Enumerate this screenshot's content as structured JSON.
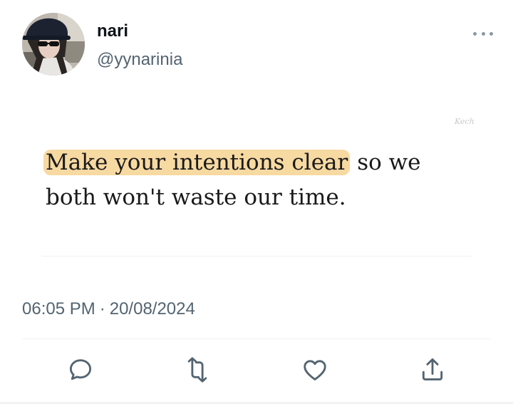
{
  "author": {
    "name": "nari",
    "handle": "@yynarinia",
    "avatar": "profile-photo"
  },
  "post": {
    "quote_highlight": "Make your intentions clear",
    "quote_rest_line1": " so we",
    "quote_line2": "both won't waste our time.",
    "highlight_color": "#f7d9a2",
    "watermark": "Kech"
  },
  "meta": {
    "time": "06:05 PM",
    "separator": "·",
    "date": "20/08/2024"
  },
  "actions": [
    {
      "name": "reply",
      "icon": "comment-icon"
    },
    {
      "name": "repost",
      "icon": "retweet-icon"
    },
    {
      "name": "like",
      "icon": "heart-icon"
    },
    {
      "name": "share",
      "icon": "share-icon"
    }
  ],
  "colors": {
    "text_primary": "#0f1419",
    "text_secondary": "#536471",
    "icon": "#536471"
  }
}
